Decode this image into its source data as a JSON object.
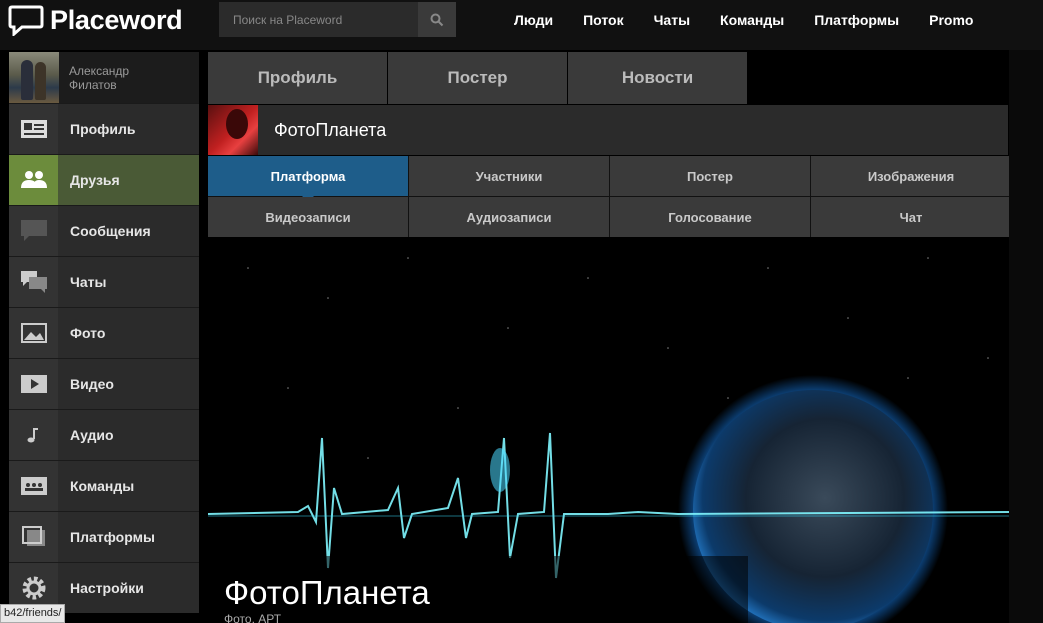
{
  "app": {
    "logo_text": "Placeword"
  },
  "search": {
    "placeholder": "Поиск на Placeword",
    "icon": "search-icon"
  },
  "nav": {
    "items": [
      "Люди",
      "Поток",
      "Чаты",
      "Команды",
      "Платформы",
      "Promo"
    ]
  },
  "user": {
    "name_line1": "Александр",
    "name_line2": "Филатов"
  },
  "sidebar": {
    "items": [
      {
        "label": "Профиль",
        "icon": "profile-card-icon"
      },
      {
        "label": "Друзья",
        "icon": "friends-icon",
        "active": true
      },
      {
        "label": "Сообщения",
        "icon": "message-icon"
      },
      {
        "label": "Чаты",
        "icon": "chats-icon"
      },
      {
        "label": "Фото",
        "icon": "photo-icon"
      },
      {
        "label": "Видео",
        "icon": "video-icon"
      },
      {
        "label": "Аудио",
        "icon": "audio-icon"
      },
      {
        "label": "Команды",
        "icon": "teams-icon"
      },
      {
        "label": "Платформы",
        "icon": "platforms-icon"
      },
      {
        "label": "Настройки",
        "icon": "gear-icon"
      }
    ]
  },
  "main_tabs": [
    "Профиль",
    "Постер",
    "Новости"
  ],
  "platform": {
    "title": "ФотоПланета"
  },
  "sub_tabs": [
    "Платформа",
    "Участники",
    "Постер",
    "Изображения",
    "Видеозаписи",
    "Аудиозаписи",
    "Голосование",
    "Чат"
  ],
  "banner": {
    "title": "ФотоПланета",
    "subtitle": "Фото, АРТ"
  },
  "status_bar": {
    "url": "b42/friends/"
  },
  "colors": {
    "active_sidebar": "#6c8c3c",
    "active_tab": "#1e5d8a",
    "background": "#000000"
  }
}
